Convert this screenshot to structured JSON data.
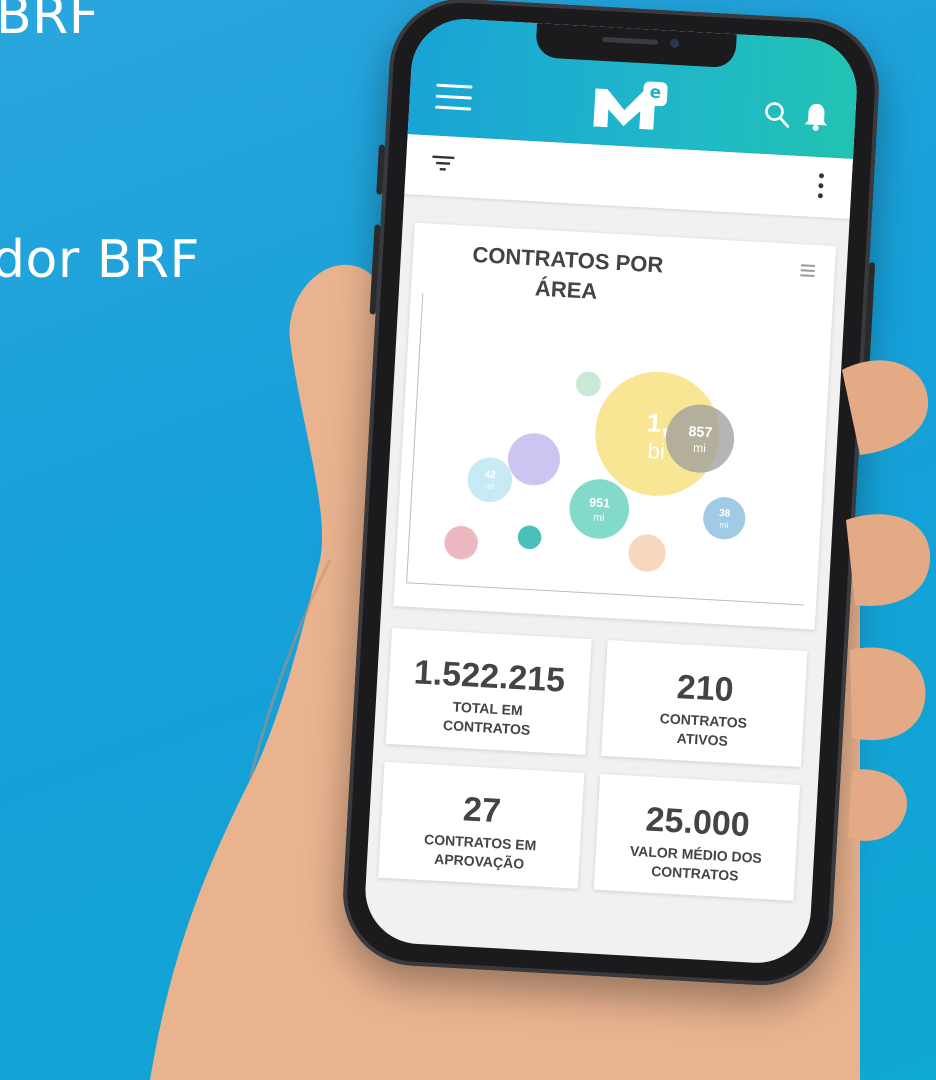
{
  "background": {
    "line_1": "BRF",
    "line_2": "dor BRF"
  },
  "app": {
    "logo_letter": "e"
  },
  "chart": {
    "title": "CONTRATOS POR ÁREA"
  },
  "chart_data": {
    "type": "scatter",
    "title": "CONTRATOS POR ÁREA",
    "bubbles": [
      {
        "label": "1,",
        "value_label": "bi",
        "color": "#f7e38a",
        "opacity": 0.9,
        "x": 0.62,
        "y": 0.62,
        "size": 1.0
      },
      {
        "label": "857",
        "value_label": "mi",
        "color": "#9c9c9c",
        "opacity": 0.75,
        "x": 0.74,
        "y": 0.61,
        "size": 0.55
      },
      {
        "label": "951",
        "value_label": "mi",
        "color": "#6dd4c1",
        "opacity": 0.85,
        "x": 0.47,
        "y": 0.28,
        "size": 0.48
      },
      {
        "label": "",
        "value_label": "",
        "color": "#bdb8ee",
        "opacity": 0.8,
        "x": 0.28,
        "y": 0.48,
        "size": 0.42
      },
      {
        "label": "42",
        "value_label": "mi",
        "color": "#bde6f3",
        "opacity": 0.85,
        "x": 0.16,
        "y": 0.38,
        "size": 0.36
      },
      {
        "label": "38",
        "value_label": "mi",
        "color": "#8ec2e0",
        "opacity": 0.85,
        "x": 0.82,
        "y": 0.27,
        "size": 0.34
      },
      {
        "label": "",
        "value_label": "",
        "color": "#f6d0b2",
        "opacity": 0.85,
        "x": 0.61,
        "y": 0.1,
        "size": 0.3
      },
      {
        "label": "",
        "value_label": "",
        "color": "#e8a7b2",
        "opacity": 0.8,
        "x": 0.09,
        "y": 0.1,
        "size": 0.27
      },
      {
        "label": "",
        "value_label": "",
        "color": "#bfe5cf",
        "opacity": 0.85,
        "x": 0.42,
        "y": 0.82,
        "size": 0.2
      },
      {
        "label": "",
        "value_label": "",
        "color": "#2cb4b0",
        "opacity": 0.85,
        "x": 0.28,
        "y": 0.14,
        "size": 0.19
      }
    ]
  },
  "kpis": [
    {
      "value": "1.522.215",
      "label": "TOTAL EM CONTRATOS"
    },
    {
      "value": "210",
      "label": "CONTRATOS ATIVOS"
    },
    {
      "value": "27",
      "label": "CONTRATOS EM APROVAÇÃO"
    },
    {
      "value": "25.000",
      "label": "VALOR MÉDIO DOS CONTRATOS"
    }
  ]
}
